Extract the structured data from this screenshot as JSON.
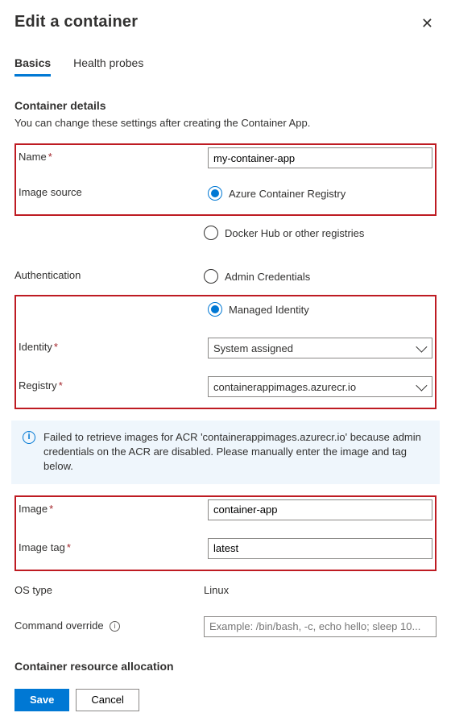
{
  "header": {
    "title": "Edit a container"
  },
  "tabs": {
    "basics": "Basics",
    "health_probes": "Health probes"
  },
  "section": {
    "details_title": "Container details",
    "details_sub": "You can change these settings after creating the Container App.",
    "resource_title": "Container resource allocation"
  },
  "labels": {
    "name": "Name",
    "image_source": "Image source",
    "authentication": "Authentication",
    "identity": "Identity",
    "registry": "Registry",
    "image": "Image",
    "image_tag": "Image tag",
    "os_type": "OS type",
    "command_override": "Command override"
  },
  "values": {
    "name": "my-container-app",
    "identity": "System assigned",
    "registry": "containerappimages.azurecr.io",
    "image": "container-app",
    "image_tag": "latest",
    "os_type": "Linux",
    "command_override_placeholder": "Example: /bin/bash, -c, echo hello; sleep 10..."
  },
  "options": {
    "image_source_acr": "Azure Container Registry",
    "image_source_docker": "Docker Hub or other registries",
    "auth_admin": "Admin Credentials",
    "auth_managed": "Managed Identity"
  },
  "info": {
    "acr_error": "Failed to retrieve images for ACR 'containerappimages.azurecr.io' because admin credentials on the ACR are disabled. Please manually enter the image and tag below."
  },
  "footer": {
    "save": "Save",
    "cancel": "Cancel"
  }
}
